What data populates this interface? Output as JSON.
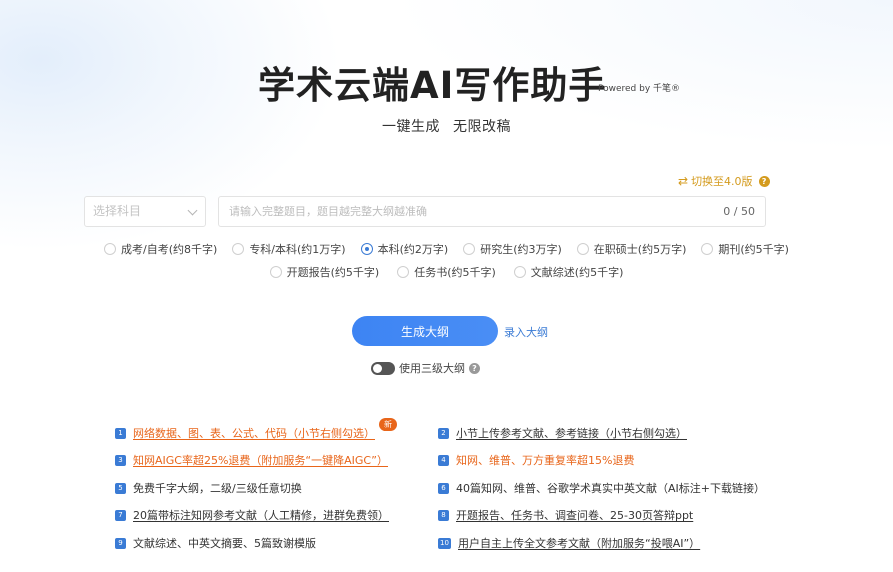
{
  "header": {
    "title": "学术云端AI写作助手",
    "powered_by": "Powered by 千笔®",
    "subtitle": "一键生成   无限改稿"
  },
  "version_switch": {
    "label": "切换至4.0版",
    "icon": "swap-arrows-icon"
  },
  "subject_select": {
    "placeholder": "选择科目"
  },
  "topic_input": {
    "placeholder": "请输入完整题目，题目越完整大纲越准确",
    "value": "",
    "counter": "0 / 50"
  },
  "paper_types": {
    "row1": [
      {
        "label": "成考/自考(约8千字)",
        "checked": false
      },
      {
        "label": "专科/本科(约1万字)",
        "checked": false
      },
      {
        "label": "本科(约2万字)",
        "checked": true
      },
      {
        "label": "研究生(约3万字)",
        "checked": false
      },
      {
        "label": "在职硕士(约5万字)",
        "checked": false
      },
      {
        "label": "期刊(约5千字)",
        "checked": false
      }
    ],
    "row2": [
      {
        "label": "开题报告(约5千字)",
        "checked": false
      },
      {
        "label": "任务书(约5千字)",
        "checked": false
      },
      {
        "label": "文献综述(约5千字)",
        "checked": false
      }
    ]
  },
  "actions": {
    "generate_label": "生成大纲",
    "enter_outline_label": "录入大纲",
    "three_level_label": "使用三级大纲",
    "three_level_enabled": false
  },
  "features": [
    {
      "num": "1",
      "text": "网络数据、图、表、公式、代码（小节右侧勾选）",
      "style": "orange-underline",
      "badge": "新"
    },
    {
      "num": "2",
      "text": "小节上传参考文献、参考链接（小节右侧勾选）",
      "style": "underline"
    },
    {
      "num": "3",
      "text": "知网AIGC率超25%退费（附加服务“一键降AIGC”）",
      "style": "orange-underline"
    },
    {
      "num": "4",
      "text": "知网、维普、万方重复率超15%退费",
      "style": "orange"
    },
    {
      "num": "5",
      "text": "免费千字大纲，二级/三级任意切换",
      "style": "plain"
    },
    {
      "num": "6",
      "text": "40篇知网、维普、谷歌学术真实中英文献（AI标注+下载链接）",
      "style": "plain"
    },
    {
      "num": "7",
      "text": "20篇带标注知网参考文献（人工精修，进群免费领）",
      "style": "underline"
    },
    {
      "num": "8",
      "text": "开题报告、任务书、调查问卷、25-30页答辩ppt",
      "style": "underline"
    },
    {
      "num": "9",
      "text": "文献综述、中英文摘要、5篇致谢模版",
      "style": "plain"
    },
    {
      "num": "10",
      "text": "用户自主上传全文参考文献（附加服务“投喂AI”）",
      "style": "underline"
    }
  ],
  "colors": {
    "primary": "#3a7bd5",
    "button": "#4a8ef5",
    "highlight": "#e8651a",
    "version_switch": "#d49b1e"
  }
}
